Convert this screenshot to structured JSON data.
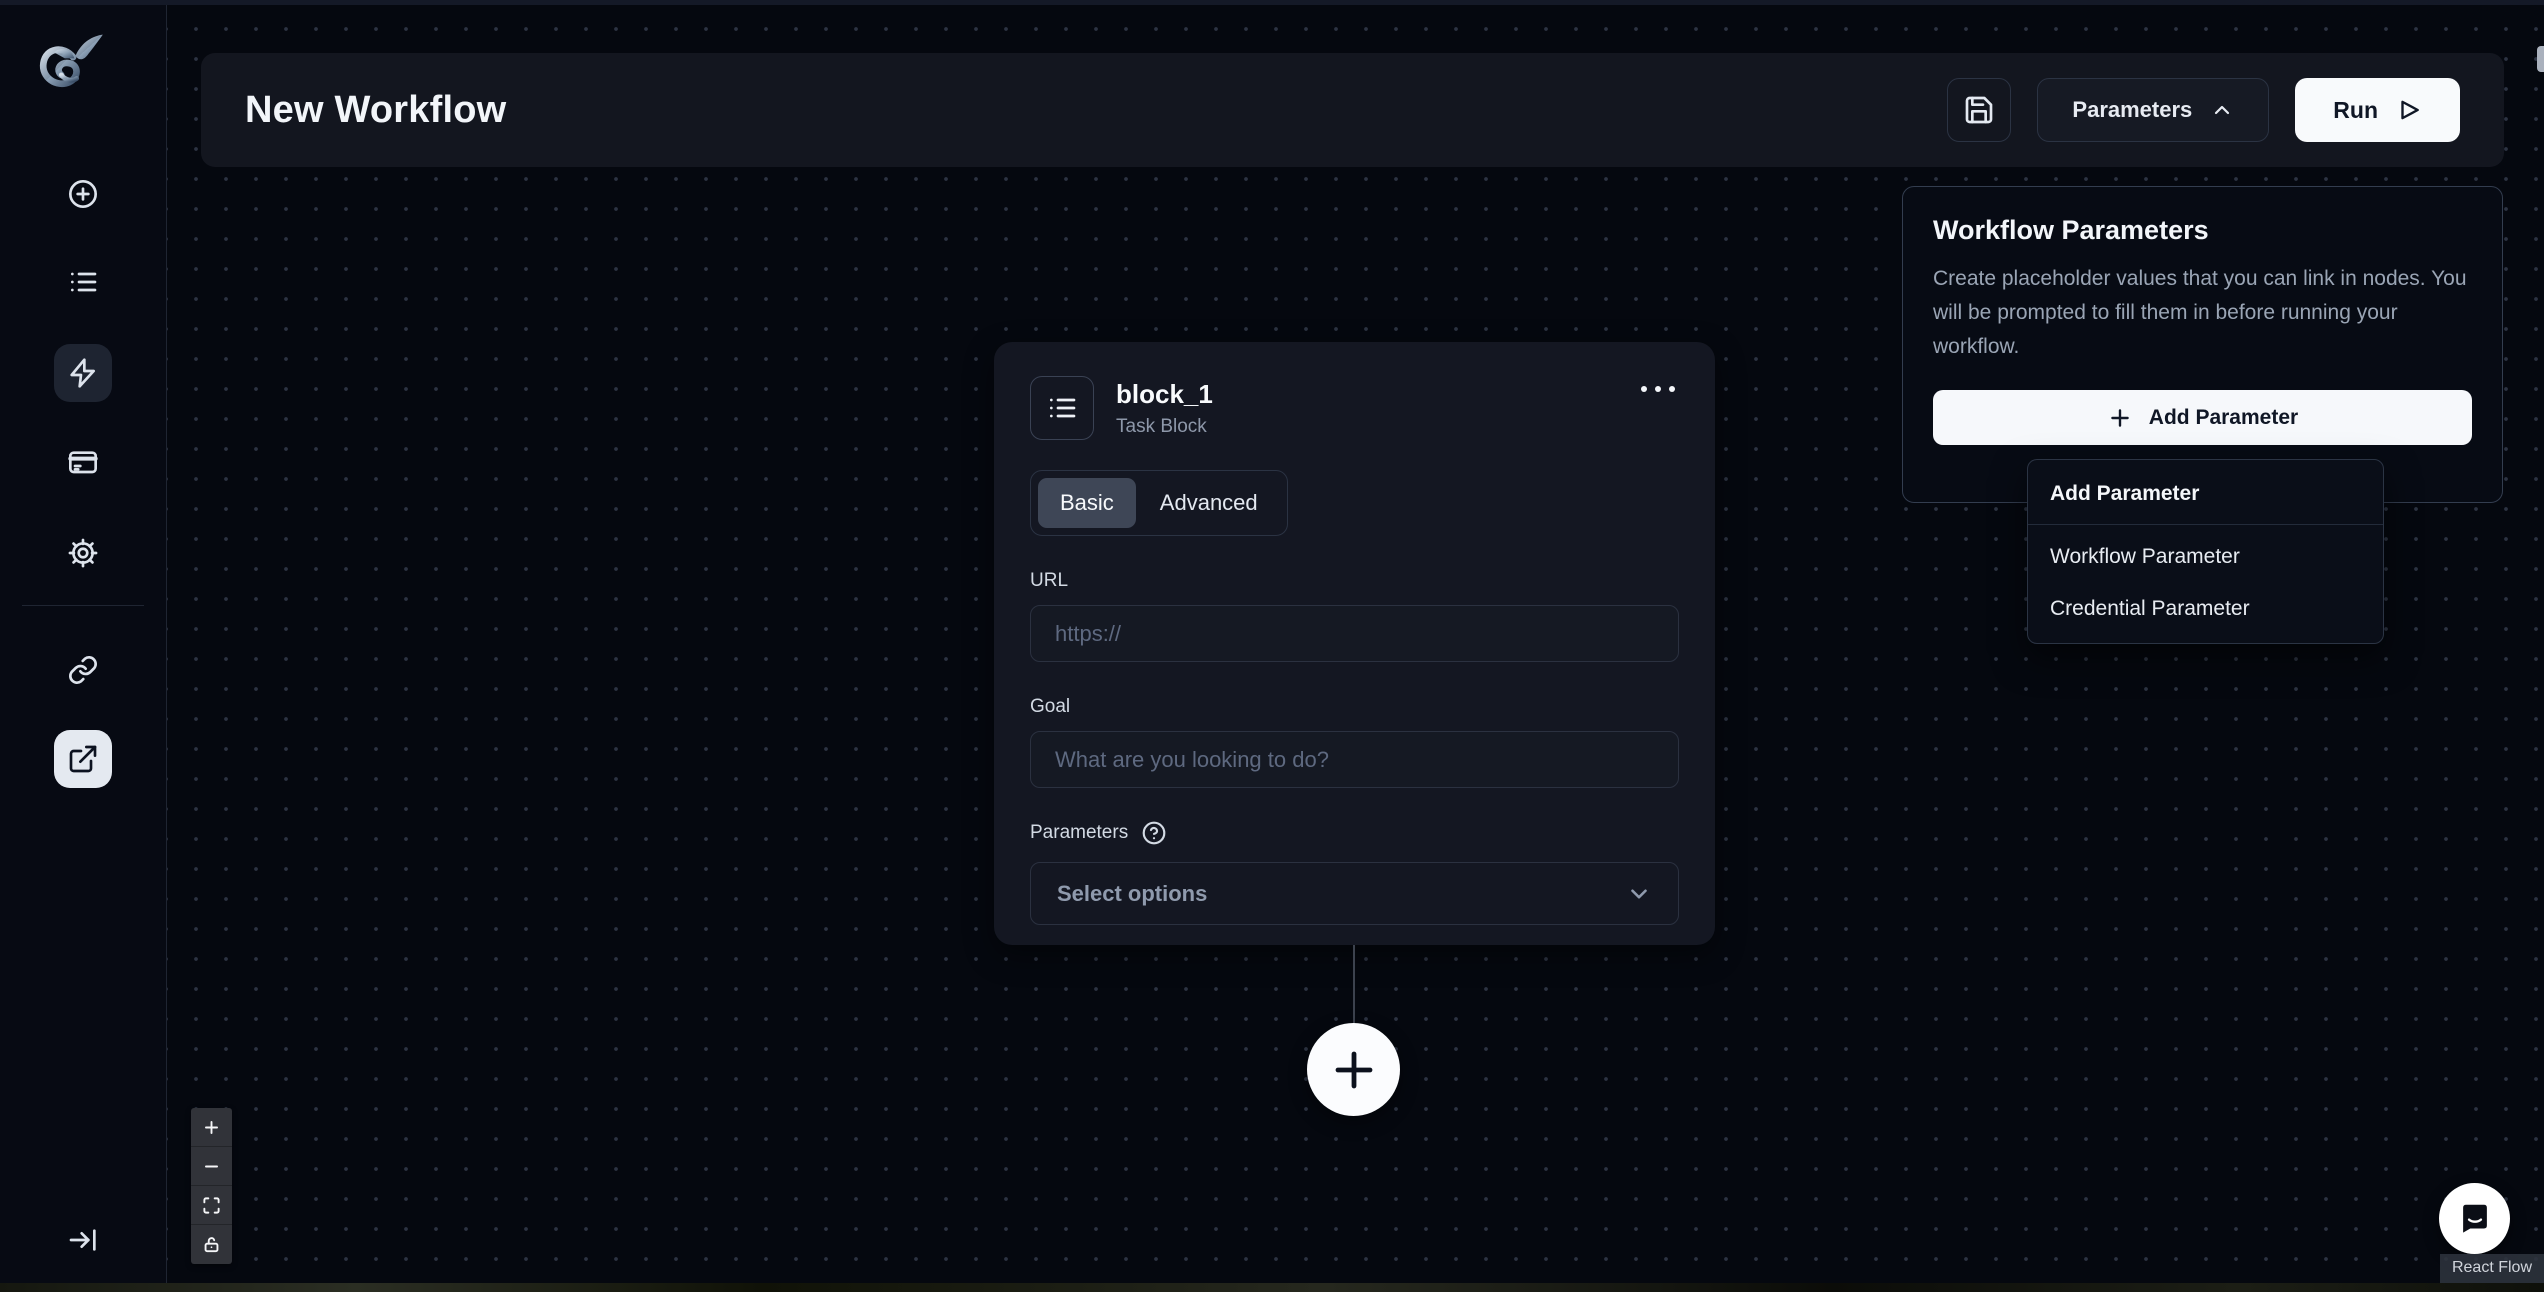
{
  "header": {
    "title": "New Workflow",
    "parameters_button": "Parameters",
    "run_button": "Run"
  },
  "sidebar": {
    "icons": [
      "logo",
      "plus-circle",
      "list",
      "zap",
      "credit-card",
      "gear",
      "link",
      "external-link",
      "collapse-arrow"
    ]
  },
  "block": {
    "name": "block_1",
    "type_label": "Task Block",
    "tabs": [
      {
        "label": "Basic"
      },
      {
        "label": "Advanced"
      }
    ],
    "active_tab": "Basic",
    "url": {
      "label": "URL",
      "placeholder": "https://",
      "value": ""
    },
    "goal": {
      "label": "Goal",
      "placeholder": "What are you looking to do?",
      "value": ""
    },
    "parameters": {
      "label": "Parameters",
      "select_placeholder": "Select options"
    }
  },
  "parameters_panel": {
    "title": "Workflow Parameters",
    "description": "Create placeholder values that you can link in nodes. You will be prompted to fill them in before running your workflow.",
    "add_button": "Add Parameter"
  },
  "add_parameter_menu": {
    "header": "Add Parameter",
    "items": [
      {
        "label": "Workflow Parameter"
      },
      {
        "label": "Credential Parameter"
      }
    ]
  },
  "attribution": {
    "label": "React Flow"
  },
  "colors": {
    "canvas_bg": "#05080f",
    "surface": "#13161f",
    "panel_border": "#333d4f",
    "active_tab_bg": "#3e4656",
    "light_button": "#f8fafc",
    "muted_text": "#94a3b8"
  }
}
